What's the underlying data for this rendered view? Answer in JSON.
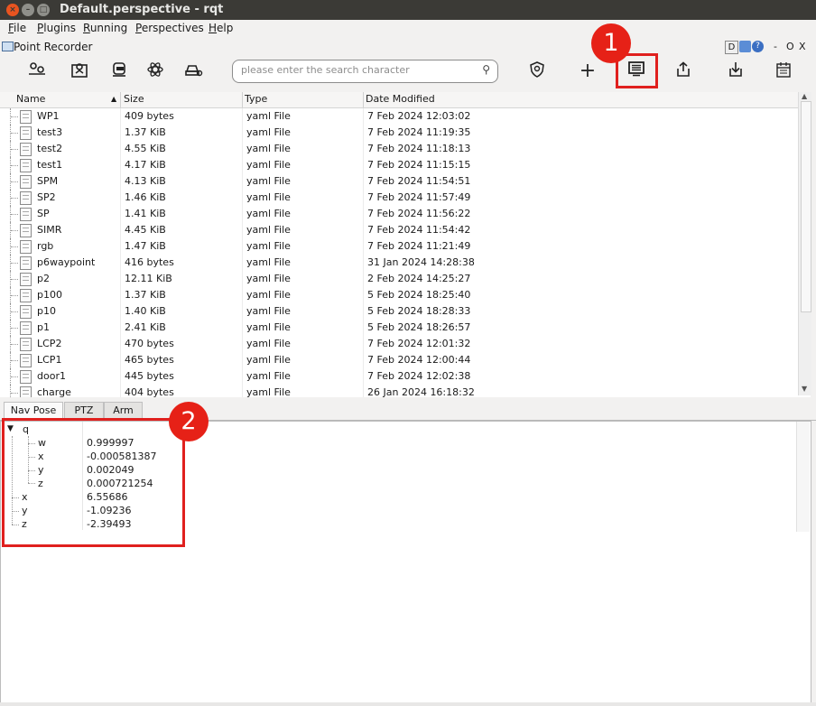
{
  "window": {
    "title": "Default.perspective - rqt",
    "close_glyph": "×",
    "min_glyph": "–",
    "max_glyph": "□"
  },
  "menu": [
    "File",
    "Plugins",
    "Running",
    "Perspectives",
    "Help"
  ],
  "plugin": {
    "title": "Point Recorder",
    "controls": {
      "d": "D",
      "dash": "-",
      "o": "O",
      "x": "X"
    }
  },
  "toolbar": {
    "search_placeholder": "please enter the search character",
    "search_glyph": "⚲",
    "left_icons": [
      "robot-settings-icon",
      "map-pin-icon",
      "robot-dock-icon",
      "atom-icon",
      "vehicle-icon"
    ],
    "right_icons": [
      "shield-icon",
      "add-icon",
      "list-view-icon",
      "export-icon",
      "import-icon",
      "calendar-icon"
    ],
    "plus_glyph": "+"
  },
  "table": {
    "headers": {
      "name": "Name",
      "size": "Size",
      "type": "Type",
      "date": "Date Modified"
    },
    "sort_glyph": "▲",
    "rows": [
      {
        "name": "WP1",
        "size": "409 bytes",
        "type": "yaml File",
        "date": "7 Feb 2024 12:03:02"
      },
      {
        "name": "test3",
        "size": "1.37 KiB",
        "type": "yaml File",
        "date": "7 Feb 2024 11:19:35"
      },
      {
        "name": "test2",
        "size": "4.55 KiB",
        "type": "yaml File",
        "date": "7 Feb 2024 11:18:13"
      },
      {
        "name": "test1",
        "size": "4.17 KiB",
        "type": "yaml File",
        "date": "7 Feb 2024 11:15:15"
      },
      {
        "name": "SPM",
        "size": "4.13 KiB",
        "type": "yaml File",
        "date": "7 Feb 2024 11:54:51"
      },
      {
        "name": "SP2",
        "size": "1.46 KiB",
        "type": "yaml File",
        "date": "7 Feb 2024 11:57:49"
      },
      {
        "name": "SP",
        "size": "1.41 KiB",
        "type": "yaml File",
        "date": "7 Feb 2024 11:56:22"
      },
      {
        "name": "SIMR",
        "size": "4.45 KiB",
        "type": "yaml File",
        "date": "7 Feb 2024 11:54:42"
      },
      {
        "name": "rgb",
        "size": "1.47 KiB",
        "type": "yaml File",
        "date": "7 Feb 2024 11:21:49"
      },
      {
        "name": "p6waypoint",
        "size": "416 bytes",
        "type": "yaml File",
        "date": "31 Jan 2024 14:28:38"
      },
      {
        "name": "p2",
        "size": "12.11 KiB",
        "type": "yaml File",
        "date": "2 Feb 2024 14:25:27"
      },
      {
        "name": "p100",
        "size": "1.37 KiB",
        "type": "yaml File",
        "date": "5 Feb 2024 18:25:40"
      },
      {
        "name": "p10",
        "size": "1.40 KiB",
        "type": "yaml File",
        "date": "5 Feb 2024 18:28:33"
      },
      {
        "name": "p1",
        "size": "2.41 KiB",
        "type": "yaml File",
        "date": "5 Feb 2024 18:26:57"
      },
      {
        "name": "LCP2",
        "size": "470 bytes",
        "type": "yaml File",
        "date": "7 Feb 2024 12:01:32"
      },
      {
        "name": "LCP1",
        "size": "465 bytes",
        "type": "yaml File",
        "date": "7 Feb 2024 12:00:44"
      },
      {
        "name": "door1",
        "size": "445 bytes",
        "type": "yaml File",
        "date": "7 Feb 2024 12:02:38"
      },
      {
        "name": "charge",
        "size": "404 bytes",
        "type": "yaml File",
        "date": "26 Jan 2024 16:18:32"
      }
    ],
    "scroll_up_glyph": "▲",
    "scroll_down_glyph": "▼"
  },
  "tabs": [
    "Nav Pose",
    "PTZ",
    "Arm"
  ],
  "nav_pose": {
    "expand_glyph": "▼",
    "q_label": "q",
    "q": [
      {
        "key": "w",
        "value": "0.999997"
      },
      {
        "key": "x",
        "value": "-0.000581387"
      },
      {
        "key": "y",
        "value": "0.002049"
      },
      {
        "key": "z",
        "value": "0.000721254"
      }
    ],
    "position": [
      {
        "key": "x",
        "value": "6.55686"
      },
      {
        "key": "y",
        "value": "-1.09236"
      },
      {
        "key": "z",
        "value": "-2.39493"
      }
    ]
  },
  "annotations": {
    "badge1": "1",
    "badge2": "2",
    "color": "#e0201e"
  }
}
